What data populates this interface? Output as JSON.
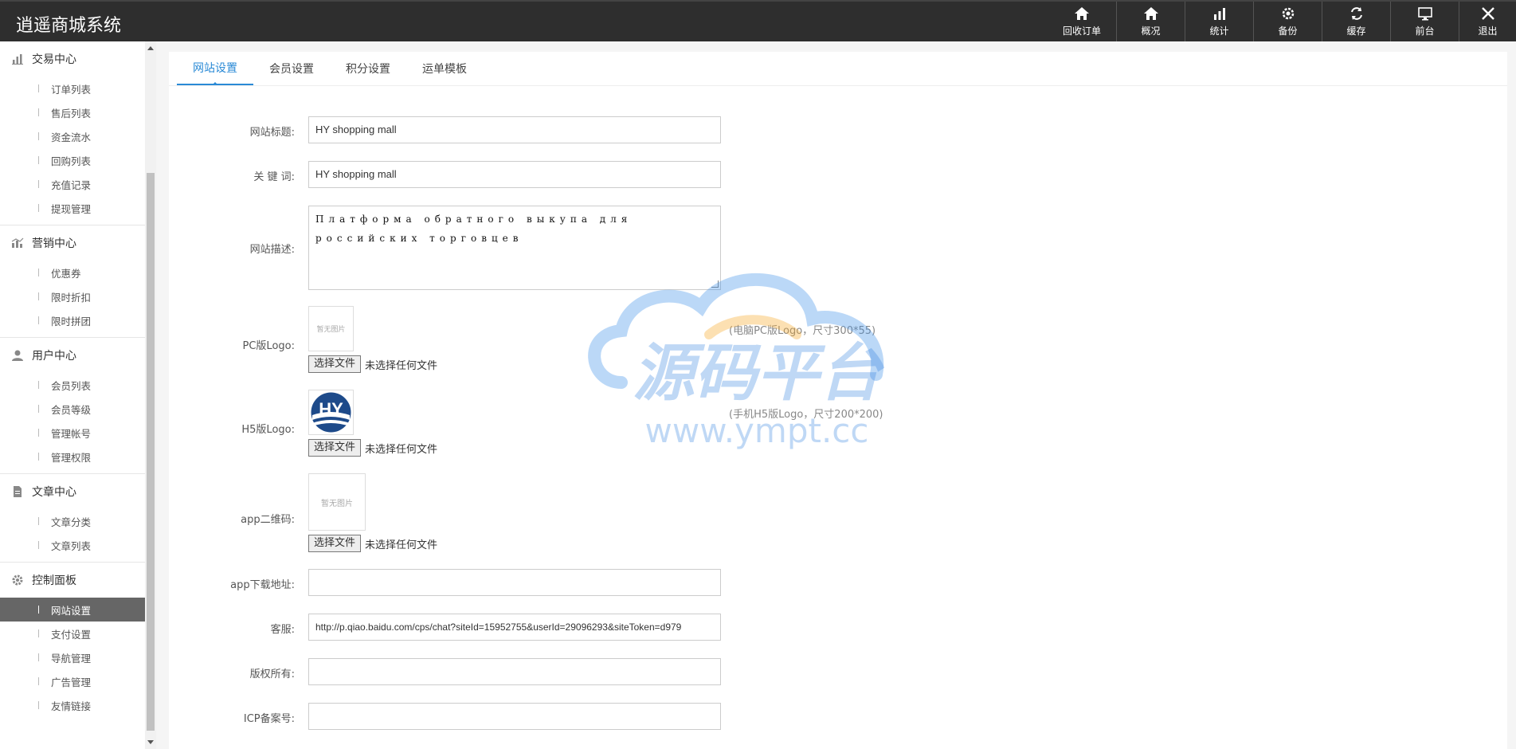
{
  "header": {
    "brand": "逍遥商城系统",
    "nav": [
      {
        "label": "回收订单",
        "icon": "home-icon"
      },
      {
        "label": "概况",
        "icon": "home-icon"
      },
      {
        "label": "统计",
        "icon": "bar-chart-icon"
      },
      {
        "label": "备份",
        "icon": "gear-icon"
      },
      {
        "label": "缓存",
        "icon": "refresh-icon"
      },
      {
        "label": "前台",
        "icon": "monitor-icon"
      },
      {
        "label": "退出",
        "icon": "close-icon"
      }
    ]
  },
  "sidebar": {
    "groups": [
      {
        "title": "交易中心",
        "icon": "bar-chart-icon",
        "items": [
          "订单列表",
          "售后列表",
          "资金流水",
          "回购列表",
          "充值记录",
          "提现管理"
        ]
      },
      {
        "title": "营销中心",
        "icon": "chart-icon",
        "items": [
          "优惠券",
          "限时折扣",
          "限时拼团"
        ]
      },
      {
        "title": "用户中心",
        "icon": "user-icon",
        "items": [
          "会员列表",
          "会员等级",
          "管理帐号",
          "管理权限"
        ]
      },
      {
        "title": "文章中心",
        "icon": "document-icon",
        "items": [
          "文章分类",
          "文章列表"
        ]
      },
      {
        "title": "控制面板",
        "icon": "gear-icon",
        "items": [
          "网站设置",
          "支付设置",
          "导航管理",
          "广告管理",
          "友情链接"
        ],
        "active": "网站设置"
      }
    ]
  },
  "tabs": [
    "网站设置",
    "会员设置",
    "积分设置",
    "运单模板"
  ],
  "active_tab": "网站设置",
  "form": {
    "site_title_label": "网站标题:",
    "site_title_value": "HY shopping mall",
    "keywords_label": "关  键  词:",
    "keywords_value": "HY shopping mall",
    "description_label": "网站描述:",
    "description_value": "Платформа обратного выкупа для российских торговцев",
    "pc_logo_label": "PC版Logo:",
    "pc_logo_placeholder": "暂无图片",
    "pc_logo_hint": "(电脑PC版Logo，尺寸300*55)",
    "h5_logo_label": "H5版Logo:",
    "h5_logo_hint": "(手机H5版Logo，尺寸200*200)",
    "h5_logo_text": "HY",
    "qr_label": "app二维码:",
    "qr_placeholder": "暂无图片",
    "file_button": "选择文件",
    "file_status": "未选择任何文件",
    "app_url_label": "app下载地址:",
    "app_url_value": "",
    "service_label": "客服:",
    "service_value": "http://p.qiao.baidu.com/cps/chat?siteId=15952755&userId=29096293&siteToken=d979",
    "copyright_label": "版权所有:",
    "copyright_value": "",
    "icp_label": "ICP备案号:",
    "icp_value": ""
  },
  "watermark": {
    "title": "源码平台",
    "url": "www.ympt.cc"
  },
  "colors": {
    "accent": "#2a8ad6",
    "header_bg": "#2e2e2e",
    "active_item_bg": "#666666"
  }
}
